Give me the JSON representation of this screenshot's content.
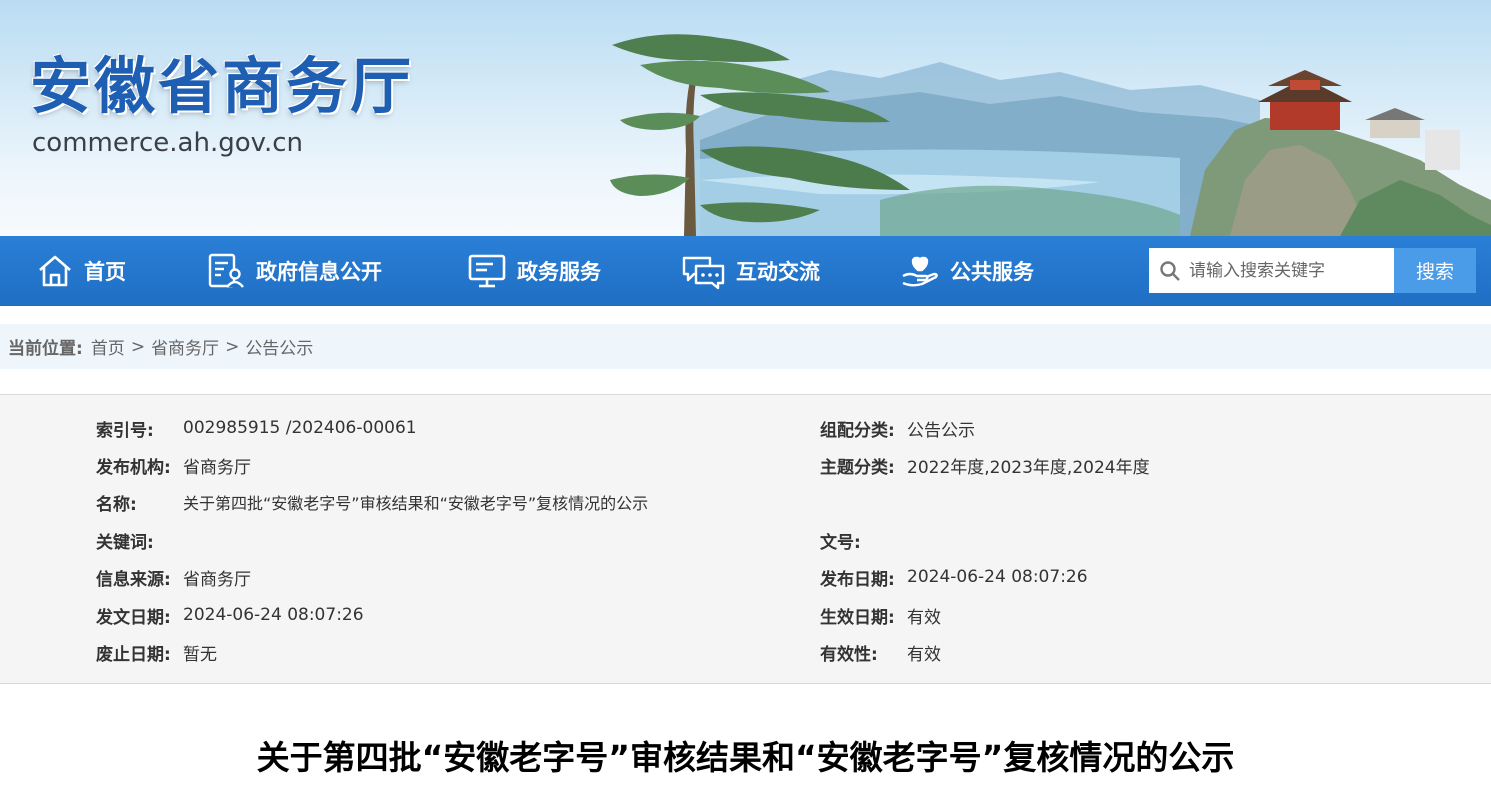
{
  "header": {
    "site_name": "安徽省商务厅",
    "site_domain": "commerce.ah.gov.cn"
  },
  "nav": {
    "items": [
      {
        "label": "首页",
        "icon": "home-icon"
      },
      {
        "label": "政府信息公开",
        "icon": "document-person-icon"
      },
      {
        "label": "政务服务",
        "icon": "monitor-icon"
      },
      {
        "label": "互动交流",
        "icon": "chat-bubbles-icon"
      },
      {
        "label": "公共服务",
        "icon": "heart-hand-icon"
      }
    ],
    "search_placeholder": "请输入搜索关键字",
    "search_button": "搜索"
  },
  "breadcrumb": {
    "label": "当前位置:",
    "items": [
      "首页",
      "省商务厅",
      "公告公示"
    ],
    "separator": ">"
  },
  "info": {
    "left": [
      {
        "label": "索引号:",
        "value": "002985915 /202406-00061"
      },
      {
        "label": "发布机构:",
        "value": "省商务厅"
      },
      {
        "label": "名称:",
        "value": "关于第四批“安徽老字号”审核结果和“安徽老字号”复核情况的公示"
      },
      {
        "label": "关键词:",
        "value": ""
      },
      {
        "label": "信息来源:",
        "value": "省商务厅"
      },
      {
        "label": "发文日期:",
        "value": "2024-06-24 08:07:26"
      },
      {
        "label": "废止日期:",
        "value": "暂无"
      }
    ],
    "right": [
      {
        "label": "组配分类:",
        "value": "公告公示"
      },
      {
        "label": "主题分类:",
        "value": "2022年度,2023年度,2024年度"
      },
      {
        "label": "文号:",
        "value": ""
      },
      {
        "label": "发布日期:",
        "value": "2024-06-24 08:07:26"
      },
      {
        "label": "生效日期:",
        "value": "有效"
      },
      {
        "label": "有效性:",
        "value": "有效"
      }
    ]
  },
  "article": {
    "title": "关于第四批“安徽老字号”审核结果和“安徽老字号”复核情况的公示"
  },
  "colors": {
    "brand_blue": "#1f6fc4",
    "title_blue": "#1e5fb3",
    "search_button": "#4a9be8",
    "breadcrumb_bg": "#eef5fb",
    "info_bg": "#f5f5f5"
  }
}
